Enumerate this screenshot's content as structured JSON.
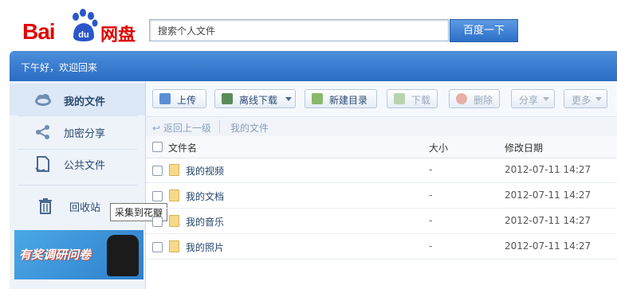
{
  "header": {
    "logo_prefix": "Bai",
    "logo_du": "du",
    "logo_suffix": "网盘",
    "search_placeholder": "搜索个人文件",
    "search_button": "百度一下"
  },
  "welcome": "下午好，欢迎回来",
  "sidebar": {
    "items": [
      {
        "label": "我的文件",
        "icon": "cloud-icon"
      },
      {
        "label": "加密分享",
        "icon": "share-icon"
      },
      {
        "label": "公共文件",
        "icon": "document-icon"
      },
      {
        "label": "回收站",
        "icon": "trash-icon"
      }
    ],
    "ad_text": "有奖调研问卷",
    "tooltip": "采集到花瓣"
  },
  "toolbar": {
    "upload": "上传",
    "offline_download": "离线下载",
    "new_folder": "新建目录",
    "download": "下载",
    "delete": "删除",
    "share": "分享",
    "more": "更多"
  },
  "breadcrumb": {
    "back": "返回上一级",
    "current": "我的文件"
  },
  "table": {
    "columns": {
      "name": "文件名",
      "size": "大小",
      "modified": "修改日期"
    },
    "rows": [
      {
        "name": "我的视频",
        "size": "-",
        "modified": "2012-07-11 14:27"
      },
      {
        "name": "我的文档",
        "size": "-",
        "modified": "2012-07-11 14:27"
      },
      {
        "name": "我的音乐",
        "size": "-",
        "modified": "2012-07-11 14:27"
      },
      {
        "name": "我的照片",
        "size": "-",
        "modified": "2012-07-11 14:27"
      }
    ]
  },
  "colors": {
    "brand_red": "#e10602",
    "brand_blue": "#2a6cc4",
    "paw_blue": "#2b56c9"
  }
}
